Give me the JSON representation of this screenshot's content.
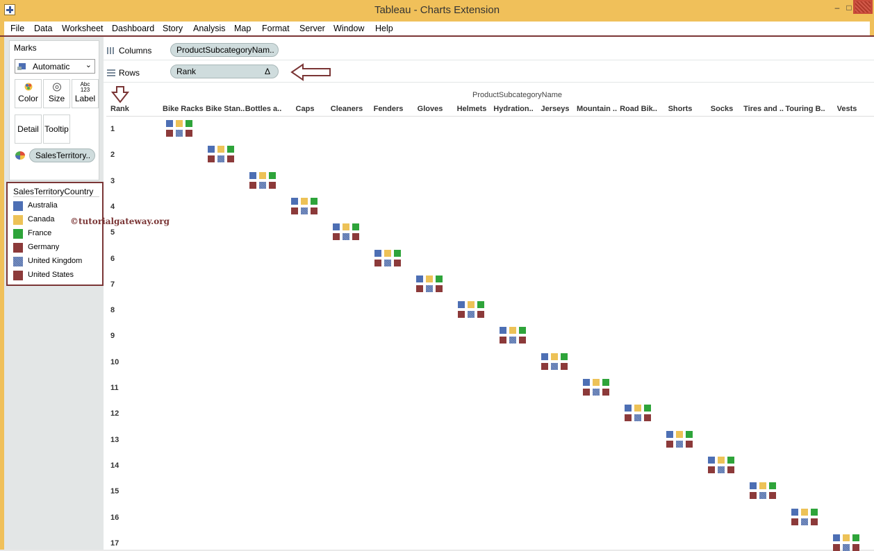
{
  "window": {
    "title": "Tableau - Charts Extension",
    "minimize": "–",
    "maximize": "□"
  },
  "menu": [
    "File",
    "Data",
    "Worksheet",
    "Dashboard",
    "Story",
    "Analysis",
    "Map",
    "Format",
    "Server",
    "Window",
    "Help"
  ],
  "marks": {
    "title": "Marks",
    "mark_type": "Automatic",
    "buttons": [
      {
        "label": "Color",
        "icon": "color-palette-icon"
      },
      {
        "label": "Size",
        "icon": "size-circle-icon"
      },
      {
        "label": "Label",
        "icon": "abc-123-icon",
        "glyph": "Abc\n123"
      },
      {
        "label": "Detail",
        "icon": ""
      },
      {
        "label": "Tooltip",
        "icon": ""
      }
    ],
    "color_field": "SalesTerritory.."
  },
  "legend": {
    "title": "SalesTerritoryCountry",
    "items": [
      {
        "label": "Australia",
        "color": "#4d6fb4"
      },
      {
        "label": "Canada",
        "color": "#edc257"
      },
      {
        "label": "France",
        "color": "#2ea43a"
      },
      {
        "label": "Germany",
        "color": "#8c3a3a"
      },
      {
        "label": "United Kingdom",
        "color": "#6b84bb",
        "pattern": "dotted"
      },
      {
        "label": "United States",
        "color": "#8c3a3a"
      }
    ]
  },
  "watermark": "©tutorialgateway.org",
  "shelves": {
    "columns_label": "Columns",
    "columns_pill": "ProductSubcategoryNam..",
    "rows_label": "Rows",
    "rows_pill": "Rank",
    "rows_pill_delta": "Δ"
  },
  "viz": {
    "column_header_title": "ProductSubcategoryName",
    "row_header_title": "Rank",
    "columns": [
      "Bike Racks",
      "Bike Stan..",
      "Bottles a..",
      "Caps",
      "Cleaners",
      "Fenders",
      "Gloves",
      "Helmets",
      "Hydration..",
      "Jerseys",
      "Mountain ..",
      "Road Bik..",
      "Shorts",
      "Socks",
      "Tires and ..",
      "Touring B..",
      "Vests"
    ],
    "ranks": [
      "1",
      "2",
      "3",
      "4",
      "5",
      "6",
      "7",
      "8",
      "9",
      "10",
      "11",
      "12",
      "13",
      "14",
      "15",
      "16",
      "17"
    ]
  }
}
